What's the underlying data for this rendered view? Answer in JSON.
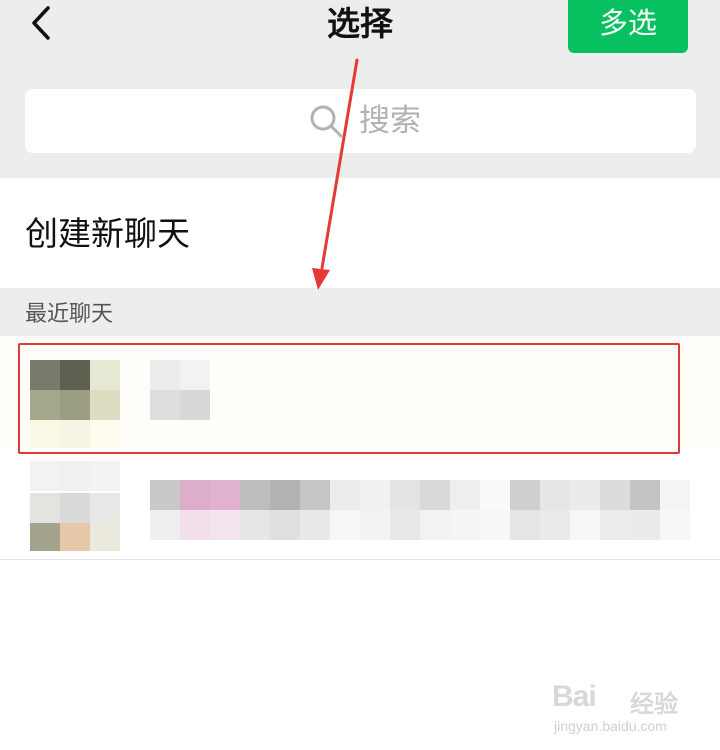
{
  "header": {
    "title": "选择",
    "multi_select_label": "多选",
    "back_icon": "chevron-left-icon"
  },
  "search": {
    "placeholder": "搜索",
    "icon": "search-icon"
  },
  "create_chat": {
    "label": "创建新聊天"
  },
  "recent": {
    "section_label": "最近聊天"
  },
  "chats": [
    {
      "name": "",
      "avatar": "pixelated-avatar",
      "highlighted": true
    },
    {
      "name": "",
      "avatar": "pixelated-avatar",
      "highlighted": false
    }
  ],
  "annotations": {
    "arrow_color": "#e53935",
    "highlight_color": "#e53935"
  },
  "watermark": {
    "brand": "Bai",
    "brand_cn": "经验",
    "url": "jingyan.baidu.com"
  },
  "colors": {
    "accent": "#07c160",
    "background": "#ededed"
  }
}
